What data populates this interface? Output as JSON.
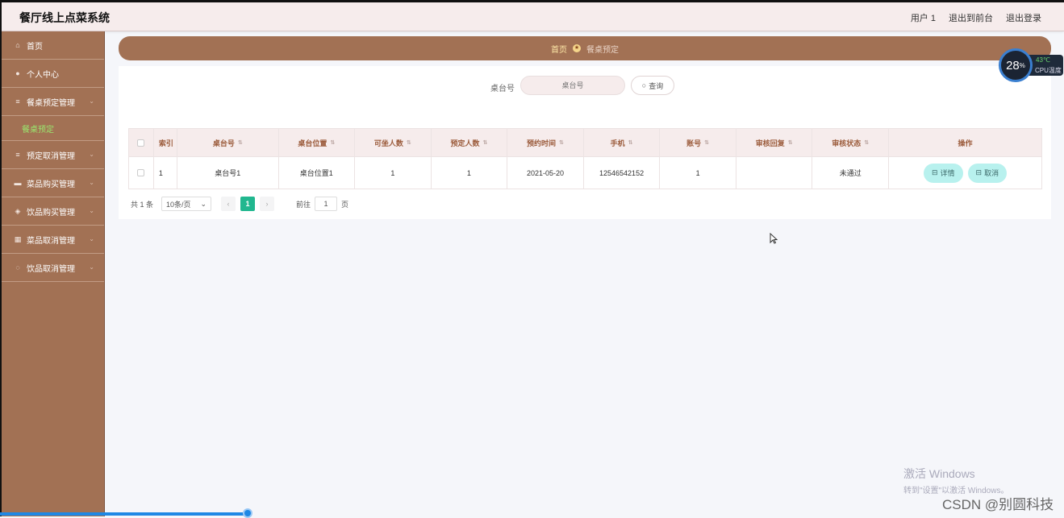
{
  "header": {
    "title": "餐厅线上点菜系统",
    "user": "用户 1",
    "to_front": "退出到前台",
    "logout": "退出登录"
  },
  "sidebar": {
    "items": [
      {
        "label": "首页",
        "icon": "home-icon",
        "glyph": "⌂"
      },
      {
        "label": "个人中心",
        "icon": "user-icon",
        "glyph": "●"
      },
      {
        "label": "餐桌预定管理",
        "icon": "menu-icon",
        "glyph": "≡",
        "chevron": "⌄",
        "submenu": "餐桌预定"
      },
      {
        "label": "预定取消管理",
        "icon": "menu-icon",
        "glyph": "≡",
        "chevron": "⌄"
      },
      {
        "label": "菜品购买管理",
        "icon": "cart-icon",
        "glyph": "▬",
        "chevron": "⌄"
      },
      {
        "label": "饮品购买管理",
        "icon": "shield-icon",
        "glyph": "◈",
        "chevron": "⌄"
      },
      {
        "label": "菜品取消管理",
        "icon": "grid-icon",
        "glyph": "▦",
        "chevron": "⌄"
      },
      {
        "label": "饮品取消管理",
        "icon": "power-icon",
        "glyph": "◌",
        "chevron": "⌄"
      }
    ]
  },
  "breadcrumb": {
    "home": "首页",
    "current": "餐桌预定",
    "separator_icon": "star-icon",
    "separator_glyph": "★"
  },
  "search": {
    "label": "桌台号",
    "placeholder": "桌台号",
    "button": "查询",
    "button_icon": "search-icon",
    "button_glyph": "○"
  },
  "table": {
    "columns": [
      "索引",
      "桌台号",
      "桌台位置",
      "可坐人数",
      "预定人数",
      "预约时间",
      "手机",
      "账号",
      "审核回复",
      "审核状态",
      "操作"
    ],
    "rows": [
      {
        "index": "1",
        "table_no": "桌台号1",
        "location": "桌台位置1",
        "capacity": "1",
        "reserved": "1",
        "time": "2021-05-20",
        "phone": "12546542152",
        "account": "1",
        "reply": "",
        "status": "未通过"
      }
    ],
    "actions": {
      "detail": "详情",
      "cancel": "取消",
      "detail_glyph": "⊟",
      "cancel_glyph": "⊟"
    }
  },
  "pagination": {
    "total": "共 1 条",
    "page_size": "10条/页",
    "current_page": "1",
    "goto_label": "前往",
    "goto_value": "1",
    "page_suffix": "页",
    "prev": "‹",
    "next": "›",
    "dropdown": "⌄"
  },
  "cpu_widget": {
    "percent": "28",
    "percent_sign": "%",
    "temp": "43℃",
    "label": "CPU温度"
  },
  "watermark": {
    "line1": "激活 Windows",
    "line2": "转到\"设置\"以激活 Windows。"
  },
  "csdn": "CSDN @别圆科技",
  "colors": {
    "brown": "#a27154",
    "header_bg": "#f6ecec",
    "accent_green": "#21b78f",
    "action_bg": "#b8f1ee",
    "submenu_text": "#9ae66e"
  }
}
